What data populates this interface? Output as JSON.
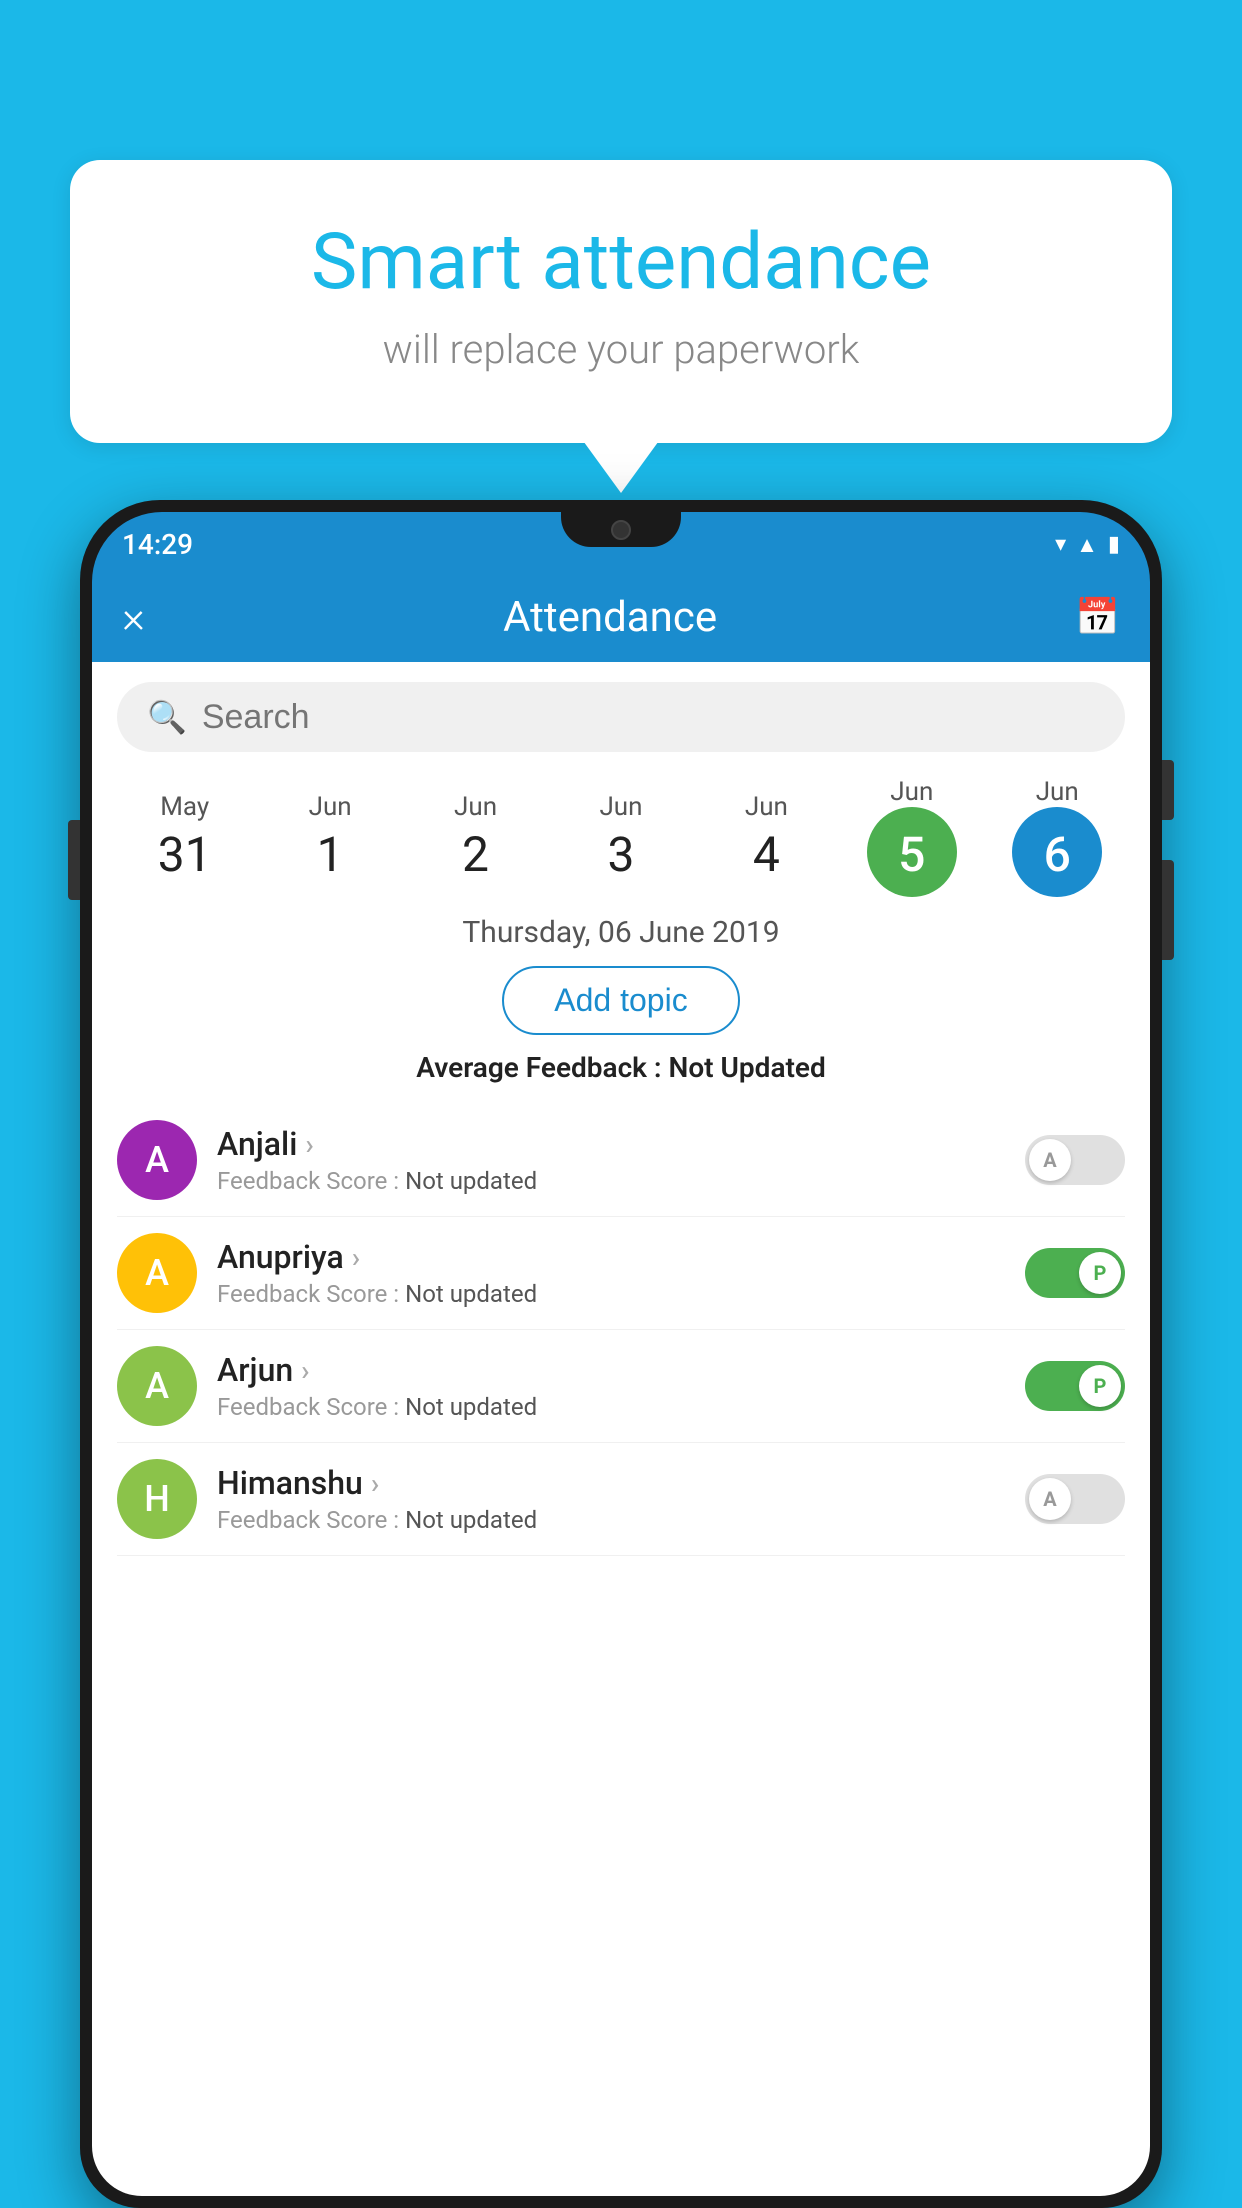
{
  "background_color": "#1BB8E8",
  "bubble": {
    "title": "Smart attendance",
    "subtitle": "will replace your paperwork"
  },
  "phone": {
    "status_bar": {
      "time": "14:29",
      "icons": [
        "wifi",
        "signal",
        "battery"
      ]
    },
    "header": {
      "title": "Attendance",
      "close_label": "×",
      "calendar_icon": "📅"
    },
    "search": {
      "placeholder": "Search"
    },
    "calendar": {
      "dates": [
        {
          "month": "May",
          "day": "31",
          "selected": false
        },
        {
          "month": "Jun",
          "day": "1",
          "selected": false
        },
        {
          "month": "Jun",
          "day": "2",
          "selected": false
        },
        {
          "month": "Jun",
          "day": "3",
          "selected": false
        },
        {
          "month": "Jun",
          "day": "4",
          "selected": false
        },
        {
          "month": "Jun",
          "day": "5",
          "selected": "green"
        },
        {
          "month": "Jun",
          "day": "6",
          "selected": "blue"
        }
      ],
      "selected_date_label": "Thursday, 06 June 2019"
    },
    "add_topic_label": "Add topic",
    "avg_feedback": {
      "label": "Average Feedback : ",
      "value": "Not Updated"
    },
    "students": [
      {
        "name": "Anjali",
        "avatar_letter": "A",
        "avatar_color": "#9C27B0",
        "feedback_label": "Feedback Score : ",
        "feedback_value": "Not updated",
        "toggle": "off",
        "toggle_letter": "A"
      },
      {
        "name": "Anupriya",
        "avatar_letter": "A",
        "avatar_color": "#FFC107",
        "feedback_label": "Feedback Score : ",
        "feedback_value": "Not updated",
        "toggle": "on",
        "toggle_letter": "P"
      },
      {
        "name": "Arjun",
        "avatar_letter": "A",
        "avatar_color": "#8BC34A",
        "feedback_label": "Feedback Score : ",
        "feedback_value": "Not updated",
        "toggle": "on",
        "toggle_letter": "P"
      },
      {
        "name": "Himanshu",
        "avatar_letter": "H",
        "avatar_color": "#8BC34A",
        "feedback_label": "Feedback Score : ",
        "feedback_value": "Not updated",
        "toggle": "off",
        "toggle_letter": "A"
      }
    ]
  }
}
